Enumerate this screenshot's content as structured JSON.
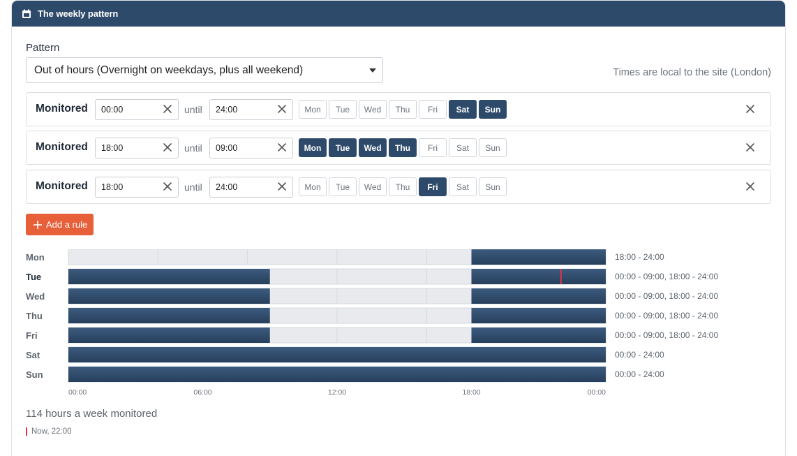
{
  "header": {
    "title": "The weekly pattern",
    "icon": "calendar-icon"
  },
  "pattern": {
    "label": "Pattern",
    "selected": "Out of hours (Overnight on weekdays, plus all weekend)",
    "timezone_note": "Times are local to the site (London)"
  },
  "day_names": [
    "Mon",
    "Tue",
    "Wed",
    "Thu",
    "Fri",
    "Sat",
    "Sun"
  ],
  "rules": [
    {
      "label": "Monitored",
      "from": "00:00",
      "until_label": "until",
      "to": "24:00",
      "days_on": [
        false,
        false,
        false,
        false,
        false,
        true,
        true
      ]
    },
    {
      "label": "Monitored",
      "from": "18:00",
      "until_label": "until",
      "to": "09:00",
      "days_on": [
        true,
        true,
        true,
        true,
        false,
        false,
        false
      ]
    },
    {
      "label": "Monitored",
      "from": "18:00",
      "until_label": "until",
      "to": "24:00",
      "days_on": [
        false,
        false,
        false,
        false,
        true,
        false,
        false
      ]
    }
  ],
  "add_rule_label": "Add a rule",
  "colors": {
    "accent": "#2e4a6b",
    "button": "#e8603a",
    "now_marker": "#e2344b",
    "empty_bar": "#e8eaed"
  },
  "chart_data": {
    "type": "timeline",
    "days": [
      "Mon",
      "Tue",
      "Wed",
      "Thu",
      "Fri",
      "Sat",
      "Sun"
    ],
    "current_day": "Tue",
    "x_ticks": [
      "00:00",
      "06:00",
      "12:00",
      "18:00",
      "00:00"
    ],
    "x_range_hours": [
      0,
      24
    ],
    "rows": [
      {
        "day": "Mon",
        "intervals": [
          [
            18,
            24
          ]
        ],
        "text": "18:00 - 24:00"
      },
      {
        "day": "Tue",
        "intervals": [
          [
            0,
            9
          ],
          [
            18,
            24
          ]
        ],
        "text": "00:00 - 09:00, 18:00 - 24:00"
      },
      {
        "day": "Wed",
        "intervals": [
          [
            0,
            9
          ],
          [
            18,
            24
          ]
        ],
        "text": "00:00 - 09:00, 18:00 - 24:00"
      },
      {
        "day": "Thu",
        "intervals": [
          [
            0,
            9
          ],
          [
            18,
            24
          ]
        ],
        "text": "00:00 - 09:00, 18:00 - 24:00"
      },
      {
        "day": "Fri",
        "intervals": [
          [
            0,
            9
          ],
          [
            18,
            24
          ]
        ],
        "text": "00:00 - 09:00, 18:00 - 24:00"
      },
      {
        "day": "Sat",
        "intervals": [
          [
            0,
            24
          ]
        ],
        "text": "00:00 - 24:00"
      },
      {
        "day": "Sun",
        "intervals": [
          [
            0,
            24
          ]
        ],
        "text": "00:00 - 24:00"
      }
    ],
    "now_marker": {
      "day": "Tue",
      "hour": 22
    }
  },
  "summary": "114 hours a week monitored",
  "now_label": "Now, 22:00"
}
